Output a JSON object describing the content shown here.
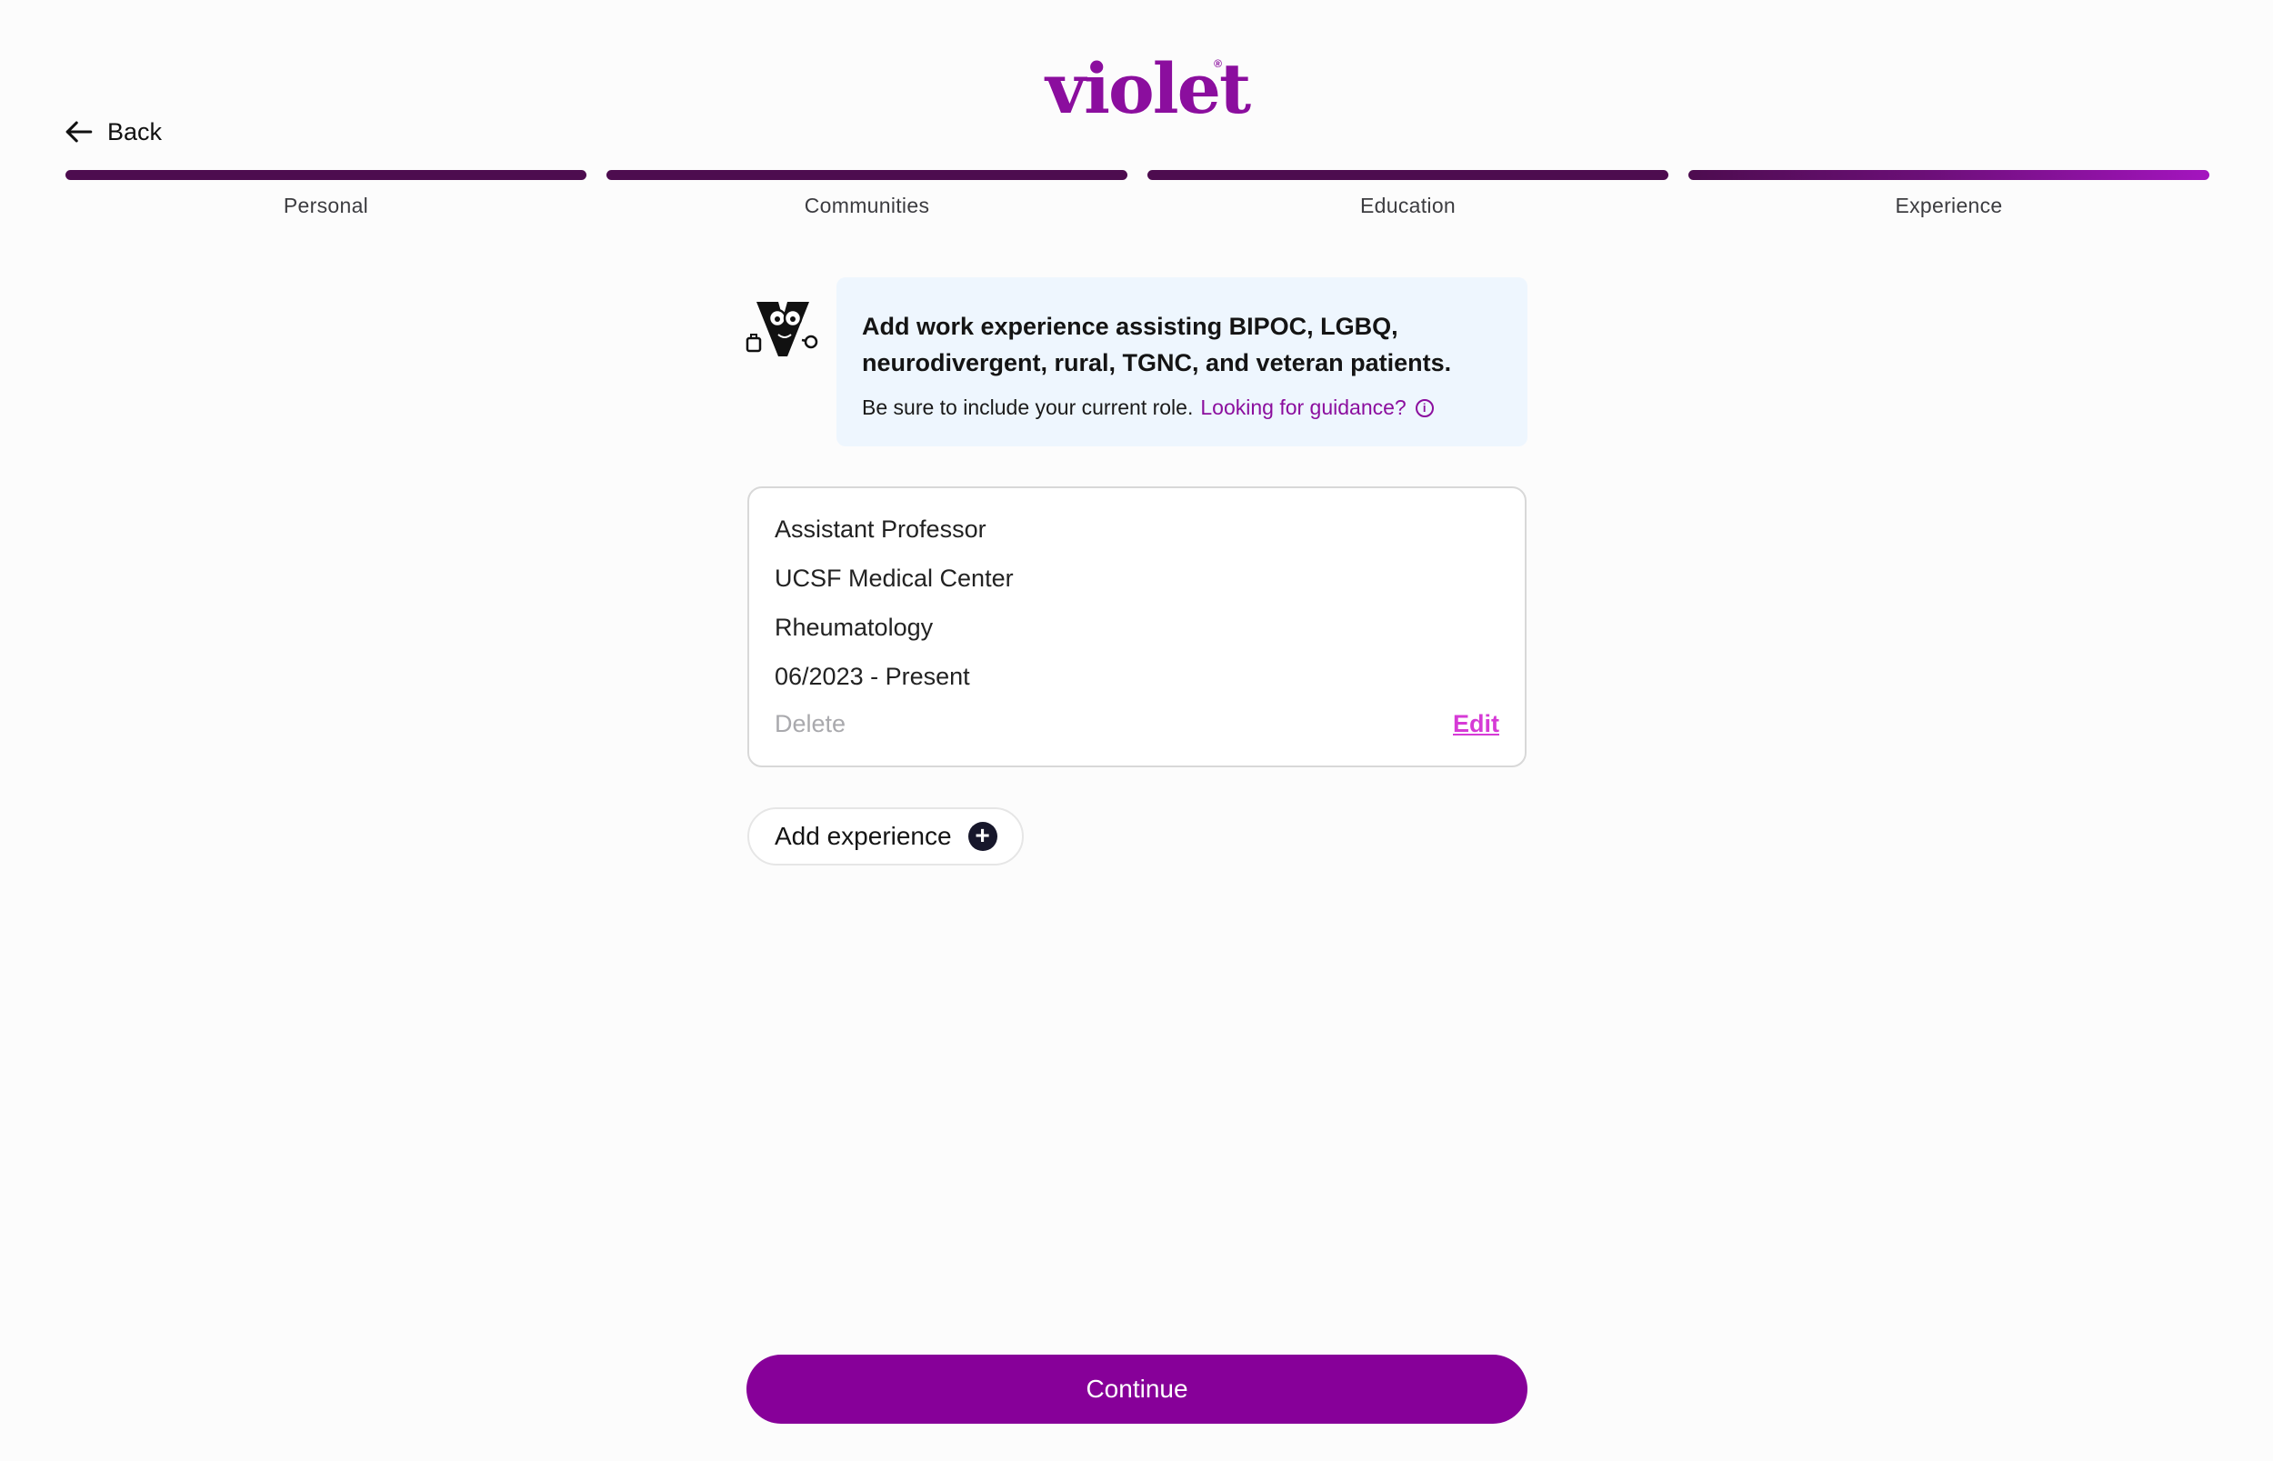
{
  "header": {
    "logo_text": "violet",
    "logo_mark": "®",
    "back_label": "Back",
    "back_icon": "arrow-left-icon"
  },
  "stepper": {
    "steps": [
      {
        "label": "Personal",
        "complete": true
      },
      {
        "label": "Communities",
        "complete": true
      },
      {
        "label": "Education",
        "complete": true
      },
      {
        "label": "Experience",
        "complete": false,
        "active": true
      }
    ]
  },
  "info": {
    "mascot_icon": "violet-v-mascot-icon",
    "headline": "Add work experience assisting BIPOC, LGBQ, neurodivergent, rural, TGNC, and veteran patients.",
    "subtext": "Be sure to include your current role.",
    "guidance_link": "Looking for guidance?",
    "guidance_icon": "info-circle-icon"
  },
  "experience": {
    "title": "Assistant Professor",
    "organization": "UCSF Medical Center",
    "specialty": "Rheumatology",
    "dates": "06/2023 - Present",
    "delete_label": "Delete",
    "edit_label": "Edit"
  },
  "add_experience": {
    "label": "Add experience",
    "icon": "plus-circle-icon"
  },
  "continue_label": "Continue",
  "colors": {
    "brand": "#870099",
    "step_complete": "#4d0c4f",
    "info_bg": "#eef6fe",
    "edit_link": "#d63ad6"
  }
}
